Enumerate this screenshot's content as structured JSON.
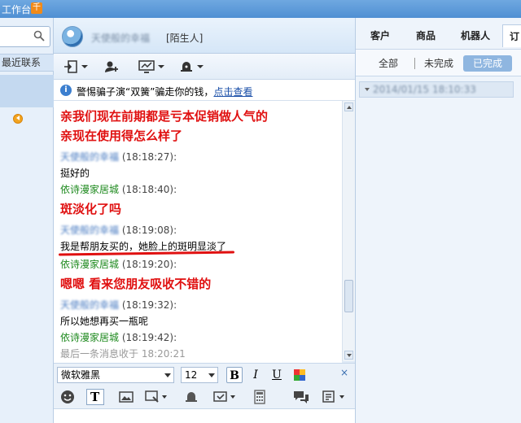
{
  "titlebar": {
    "title": "工作台",
    "logo_glyph": "千"
  },
  "sidebar": {
    "search_placeholder": "",
    "recent_label": "最近联系"
  },
  "chat": {
    "contact_name": "天使般的幸福",
    "contact_tag": "[陌生人]",
    "warning_text": "警惕骗子演“双簧”骗走你的钱，",
    "warning_link": "点击查看",
    "messages": [
      {
        "kind": "big",
        "text": "亲我们现在前期都是亏本促销做人气的"
      },
      {
        "kind": "big",
        "text": "亲现在使用得怎么样了"
      },
      {
        "kind": "sender",
        "sender": "天使般的幸福",
        "time": "(18:18:27):",
        "blur": true
      },
      {
        "kind": "body",
        "text": "挺好的"
      },
      {
        "kind": "sender",
        "sender": "依诗漫家居城",
        "time": "(18:18:40):",
        "blur": false
      },
      {
        "kind": "big",
        "text": "斑淡化了吗"
      },
      {
        "kind": "sender",
        "sender": "天使般的幸福",
        "time": "(18:19:08):",
        "blur": true
      },
      {
        "kind": "body",
        "text": "我是帮朋友买的，她脸上的斑明显淡了"
      },
      {
        "kind": "sender",
        "sender": "依诗漫家居城",
        "time": "(18:19:20):",
        "blur": false
      },
      {
        "kind": "big",
        "text": "嗯嗯 看来您朋友吸收不错的"
      },
      {
        "kind": "sender",
        "sender": "天使般的幸福",
        "time": "(18:19:32):",
        "blur": true
      },
      {
        "kind": "body",
        "text": "所以她想再买一瓶呢"
      },
      {
        "kind": "sender",
        "sender": "依诗漫家居城",
        "time": "(18:19:42):",
        "blur": false
      }
    ],
    "last_message": "最后一条消息收于  18:20:21",
    "font_name": "微软雅黑",
    "font_size": "12",
    "format_buttons": {
      "bold": "B",
      "italic": "I",
      "underline": "U"
    },
    "close_glyph": "×"
  },
  "right_panel": {
    "tabs": [
      "客户",
      "商品",
      "机器人",
      "订"
    ],
    "filters": [
      "全部",
      "未完成",
      "已完成"
    ],
    "active_filter": "已完成",
    "order_item": "2014/01/15 18:10:33"
  },
  "colors": {
    "accent": "#3c7fcf",
    "highlight_red": "#e01010",
    "seller_green": "#1f8a1f"
  }
}
